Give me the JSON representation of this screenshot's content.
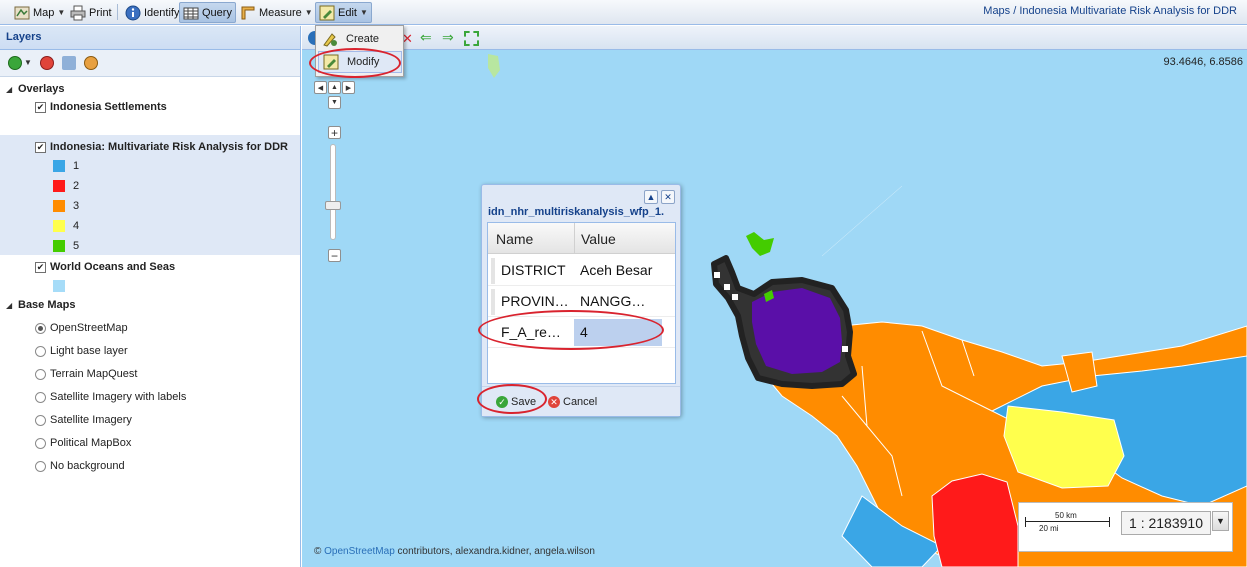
{
  "toolbar": {
    "map_label": "Map",
    "print_label": "Print",
    "identify_label": "Identify",
    "query_label": "Query",
    "measure_label": "Measure",
    "edit_label": "Edit",
    "breadcrumb": "Maps / Indonesia Multivariate Risk Analysis for DDR"
  },
  "edit_menu": {
    "items": [
      {
        "label": "Create",
        "icon": "create-feature-icon"
      },
      {
        "label": "Modify",
        "icon": "modify-feature-icon"
      }
    ]
  },
  "layers": {
    "header": "Layers",
    "overlays_label": "Overlays",
    "overlays": [
      {
        "label": "Indonesia Settlements",
        "checked": true
      },
      {
        "label": "Indonesia: Multivariate Risk Analysis for DDR",
        "checked": true,
        "selected": true,
        "legend": [
          {
            "label": "1",
            "color": "#3aa6e6"
          },
          {
            "label": "2",
            "color": "#ff1a1a"
          },
          {
            "label": "3",
            "color": "#ff8c00"
          },
          {
            "label": "4",
            "color": "#ffff4d"
          },
          {
            "label": "5",
            "color": "#44cc00"
          }
        ]
      },
      {
        "label": "World Oceans and Seas",
        "checked": true,
        "legend_color": "#a6dcf8"
      }
    ],
    "base_maps_label": "Base Maps",
    "base_maps": [
      {
        "label": "OpenStreetMap",
        "selected": true
      },
      {
        "label": "Light base layer",
        "selected": false
      },
      {
        "label": "Terrain MapQuest",
        "selected": false
      },
      {
        "label": "Satellite Imagery with labels",
        "selected": false
      },
      {
        "label": "Satellite Imagery",
        "selected": false
      },
      {
        "label": "Political MapBox",
        "selected": false
      },
      {
        "label": "No background",
        "selected": false
      }
    ]
  },
  "map": {
    "coordinates": "93.4646, 6.8586",
    "attribution_link": "OpenStreetMap",
    "attribution_rest": " contributors, alexandra.kidner, angela.wilson",
    "scale_value": "1 : 2183910",
    "scale_km": "50 km",
    "scale_mi": "20 mi",
    "colors": {
      "sea": "#9fd8f6",
      "class1": "#3aa6e6",
      "class2": "#ff1a1a",
      "class3": "#ff8c00",
      "class4": "#ffff4d",
      "class5": "#44cc00",
      "selected_feature": "#5a0fa8"
    }
  },
  "feature_dialog": {
    "title": "idn_nhr_multiriskanalysis_wfp_1.",
    "col_name": "Name",
    "col_value": "Value",
    "rows": [
      {
        "name": "DISTRICT",
        "value": "Aceh Besar"
      },
      {
        "name": "PROVIN…",
        "value": "NANGG…"
      },
      {
        "name": "F_A_re…",
        "value": "4"
      }
    ],
    "save_label": "Save",
    "cancel_label": "Cancel"
  }
}
